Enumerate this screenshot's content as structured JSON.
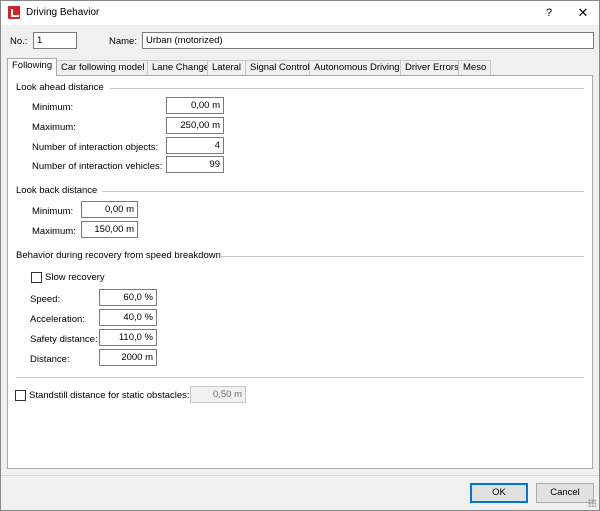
{
  "window": {
    "title": "Driving Behavior",
    "help": "?",
    "close": "✕"
  },
  "header": {
    "no_label": "No.:",
    "no_value": "1",
    "name_label": "Name:",
    "name_value": "Urban (motorized)"
  },
  "tabs": [
    {
      "label": "Following",
      "active": true
    },
    {
      "label": "Car following model"
    },
    {
      "label": "Lane Change"
    },
    {
      "label": "Lateral"
    },
    {
      "label": "Signal Control"
    },
    {
      "label": "Autonomous Driving"
    },
    {
      "label": "Driver Errors"
    },
    {
      "label": "Meso"
    }
  ],
  "look_ahead": {
    "title": "Look ahead distance",
    "minimum_label": "Minimum:",
    "minimum_value": "0,00 m",
    "maximum_label": "Maximum:",
    "maximum_value": "250,00 m",
    "objects_label": "Number of interaction objects:",
    "objects_value": "4",
    "vehicles_label": "Number of interaction vehicles:",
    "vehicles_value": "99"
  },
  "look_back": {
    "title": "Look back distance",
    "minimum_label": "Minimum:",
    "minimum_value": "0,00 m",
    "maximum_label": "Maximum:",
    "maximum_value": "150,00 m"
  },
  "recovery": {
    "title": "Behavior during recovery from speed breakdown",
    "slow_label": "Slow recovery",
    "speed_label": "Speed:",
    "speed_value": "60,0 %",
    "accel_label": "Acceleration:",
    "accel_value": "40,0 %",
    "safety_label": "Safety distance:",
    "safety_value": "110,0 %",
    "distance_label": "Distance:",
    "distance_value": "2000 m"
  },
  "standstill": {
    "label": "Standstill distance for static obstacles:",
    "value": "0,50 m"
  },
  "buttons": {
    "ok": "OK",
    "cancel": "Cancel"
  }
}
